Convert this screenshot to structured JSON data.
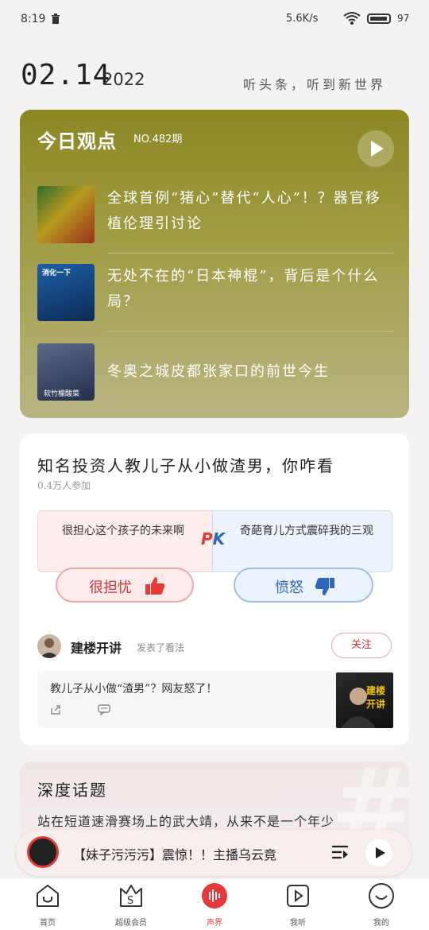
{
  "status": {
    "time": "8:19",
    "speed": "5.6K/s",
    "net": "HD",
    "battery": "97"
  },
  "header": {
    "date": "02.14",
    "year": "2022",
    "slogan": "听头条，听到新世界"
  },
  "daily": {
    "logo": "今日观点",
    "issue": "NO.482期",
    "items": [
      {
        "title": "全球首例“猪心”替代“人心”！？器官移植伦理引讨论"
      },
      {
        "title": "无处不在的“日本神棍”，背后是个什么局？",
        "thumb_tag": "消化一下"
      },
      {
        "title": "冬奥之城皮都张家口的前世今生",
        "thumb_tag": "软竹檬酸菜"
      }
    ]
  },
  "pk": {
    "title": "知名投资人教儿子从小做渣男，你咋看",
    "participants": "0.4万人参加",
    "left_option": "很担心这个孩子的未来啊",
    "right_option": "奇葩育儿方式震碎我的三观",
    "vs": "PK",
    "left_button": "很担忧",
    "right_button": "愤怒",
    "author": "建楼开讲",
    "author_action": "发表了看法",
    "follow": "关注",
    "quote": "教儿子从小做“渣男”？网友怒了！",
    "quote_thumb_tag": "建楼开讲"
  },
  "deep": {
    "title": "深度话题",
    "text": "站在短道速滑赛场上的武大靖，从来不是一个年少"
  },
  "player": {
    "text": "【妹子污污污】震惊！！主播乌云竟"
  },
  "nav": {
    "items": [
      {
        "label": "首页"
      },
      {
        "label": "超级会员"
      },
      {
        "label": "声界"
      },
      {
        "label": "我听"
      },
      {
        "label": "我的"
      }
    ]
  },
  "colors": {
    "accent": "#e63a3a",
    "daily_bg": "#9a9440",
    "angry_blue": "#2e66b8"
  }
}
